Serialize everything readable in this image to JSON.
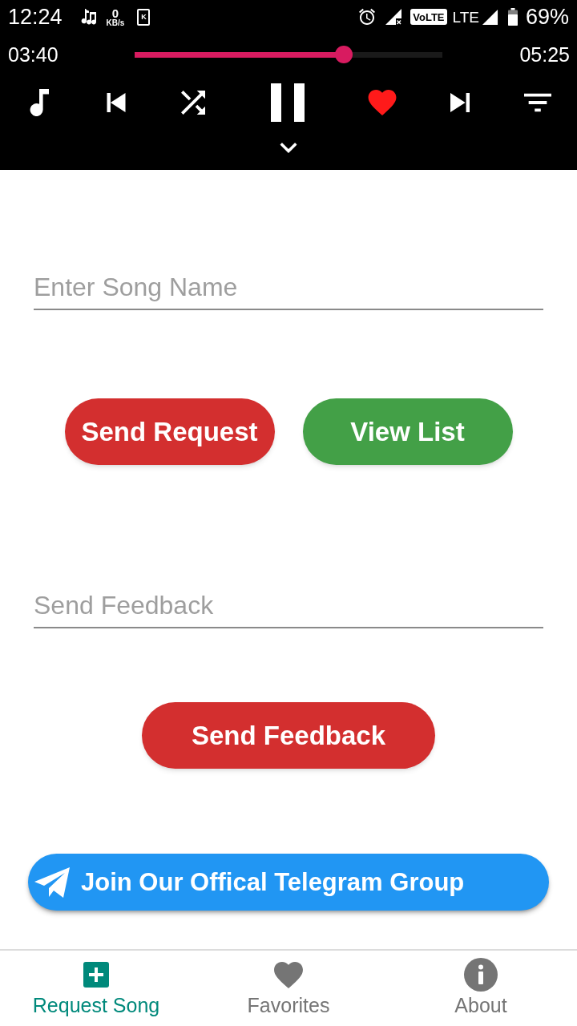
{
  "status_bar": {
    "time": "12:24",
    "speed_value": "0",
    "speed_unit": "KB/s",
    "notification_badge": "K",
    "volte": "VoLTE",
    "network": "LTE",
    "battery": "69%"
  },
  "player": {
    "elapsed": "03:40",
    "duration": "05:25",
    "level": 0.68,
    "playing": true,
    "favorite": true
  },
  "song_request": {
    "field": {
      "placeholder": "Enter Song Name"
    },
    "buttons": [
      {
        "label": "Send Request",
        "color": "#d32f2f"
      },
      {
        "label": "View List",
        "color": "#43a047"
      }
    ]
  },
  "feedback": {
    "field": {
      "placeholder": "Send Feedback"
    },
    "button": {
      "label": "Send Feedback"
    }
  },
  "telegram_button": {
    "label": "Join Our Offical Telegram Group"
  },
  "bottom_nav": [
    {
      "label": "Request Song",
      "selected": true
    },
    {
      "label": "Favorites",
      "selected": false
    },
    {
      "label": "About",
      "selected": false
    }
  ]
}
